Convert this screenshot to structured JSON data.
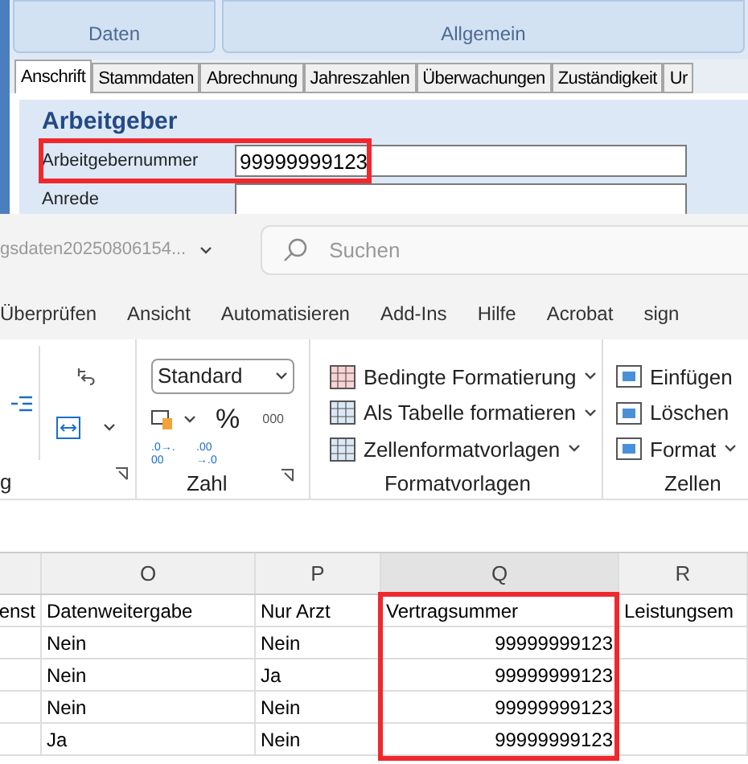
{
  "top_app": {
    "ribbon_groups": [
      "Daten",
      "Allgemein"
    ],
    "tabs": [
      {
        "label": "Anschrift",
        "selected": true
      },
      {
        "label": "Stammdaten",
        "selected": false
      },
      {
        "label": "Abrechnung",
        "selected": false
      },
      {
        "label": "Jahreszahlen",
        "selected": false
      },
      {
        "label": "Überwachungen",
        "selected": false
      },
      {
        "label": "Zuständigkeit",
        "selected": false
      },
      {
        "label": "Ur",
        "selected": false
      }
    ],
    "section_title": "Arbeitgeber",
    "fields": [
      {
        "label": "Arbeitgebernummer",
        "value": "99999999123",
        "highlighted": true
      },
      {
        "label": "Anrede",
        "highlighted": false
      }
    ]
  },
  "excel": {
    "file_name": "gsdaten20250806154...",
    "search": {
      "placeholder": "Suchen"
    },
    "menu": [
      "Überprüfen",
      "Ansicht",
      "Automatisieren",
      "Add-Ins",
      "Hilfe",
      "Acrobat",
      "sign"
    ],
    "ribbon": {
      "left_group_label": "g",
      "number_format": "Standard",
      "number_group_label": "Zahl",
      "percent": "%",
      "thousands": "000",
      "decimal_increase": ".0→.00",
      "decimal_decrease": ".00→.0",
      "styles": [
        "Bedingte Formatierung",
        "Als Tabelle formatieren",
        "Zellenformatvorlagen"
      ],
      "styles_group_label": "Formatvorlagen",
      "cells": [
        "Einfügen",
        "Löschen",
        "Format"
      ],
      "cells_group_label": "Zellen"
    },
    "columns": [
      {
        "highlighted": false
      },
      {
        "letter": "O",
        "highlighted": false
      },
      {
        "letter": "P",
        "highlighted": false
      },
      {
        "letter": "Q",
        "highlighted": true
      },
      {
        "letter": "R",
        "highlighted": false
      }
    ],
    "rows": [
      [
        "enst",
        "Datenweitergabe",
        "Nur Arzt",
        "Vertragsummer",
        "Leistungsem"
      ],
      [
        "",
        "Nein",
        "Nein",
        "99999999123",
        ""
      ],
      [
        "",
        "Nein",
        "Ja",
        "99999999123",
        ""
      ],
      [
        "",
        "Nein",
        "Nein",
        "99999999123",
        ""
      ],
      [
        "",
        "Ja",
        "Nein",
        "99999999123",
        ""
      ]
    ]
  }
}
